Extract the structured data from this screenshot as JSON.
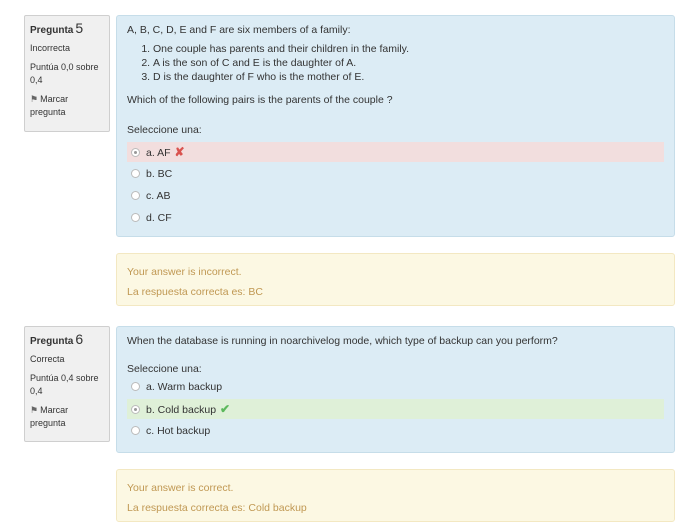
{
  "q5": {
    "label": "Pregunta",
    "number": "5",
    "state": "Incorrecta",
    "grade": "Puntúa 0,0 sobre 0,4",
    "flag_label": "Marcar pregunta",
    "intro": "A, B, C, D, E and F are six members of a family:",
    "facts": [
      "One couple has parents and their children in the family.",
      "A is the son of C and E is the daughter of A.",
      "D is the daughter of F who is the mother of E."
    ],
    "question": "Which of the following pairs is the parents of the couple ?",
    "select_label": "Seleccione una:",
    "options": [
      "a. AF",
      "b. BC",
      "c. AB",
      "d. CF"
    ],
    "selected_index": 0,
    "result_icon": "cross-icon",
    "feedback_status": "Your answer is incorrect.",
    "feedback_correct": "La respuesta correcta es: BC"
  },
  "q6": {
    "label": "Pregunta",
    "number": "6",
    "state": "Correcta",
    "grade": "Puntúa 0,4 sobre 0,4",
    "flag_label": "Marcar pregunta",
    "question": "When the database is running in noarchivelog mode, which type of backup can you perform?",
    "select_label": "Seleccione una:",
    "options": [
      "a. Warm backup",
      "b. Cold backup",
      "c. Hot backup"
    ],
    "selected_index": 1,
    "result_icon": "check-icon",
    "feedback_status": "Your answer is correct.",
    "feedback_correct": "La respuesta correcta es: Cold backup"
  },
  "colors": {
    "content_bg": "#dcecf5",
    "feedback_bg": "#fcf8e3",
    "feedback_text": "#c09853",
    "incorrect_bg": "#f2dede",
    "correct_bg": "#dff0d8",
    "cross": "#d9534f",
    "check": "#5cb85c"
  }
}
